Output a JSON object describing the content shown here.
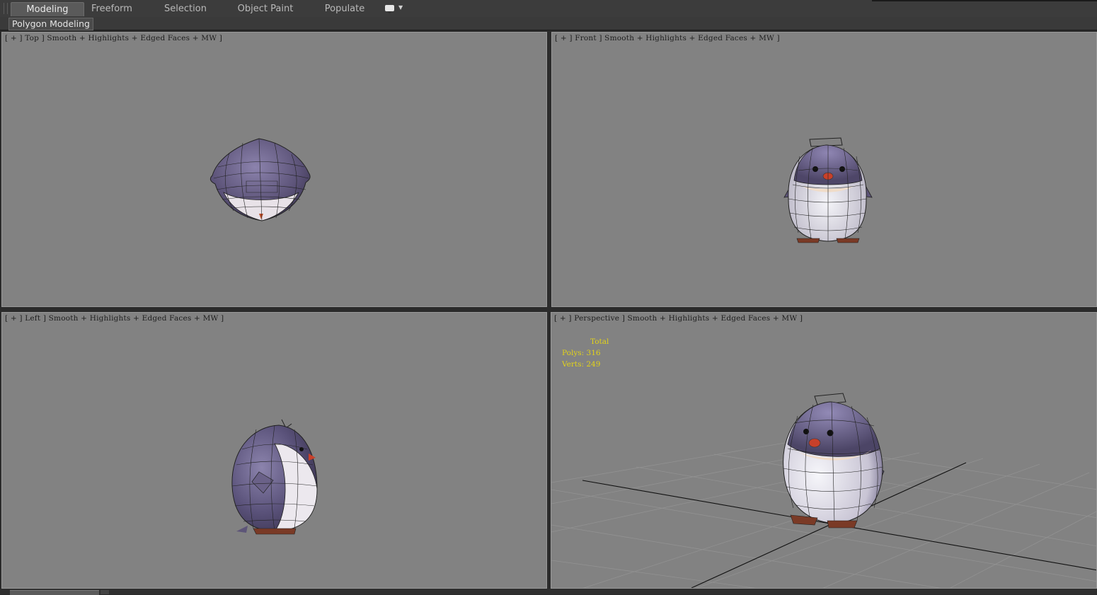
{
  "ribbon": {
    "tabs": [
      {
        "label": "Modeling",
        "active": true
      },
      {
        "label": "Freeform",
        "active": false
      },
      {
        "label": "Selection",
        "active": false
      },
      {
        "label": "Object Paint",
        "active": false
      },
      {
        "label": "Populate",
        "active": false
      }
    ],
    "panel_label": "Polygon Modeling"
  },
  "viewports": {
    "top": {
      "label": "[ + ] Top ] Smooth + Highlights + Edged Faces + MW ]"
    },
    "front": {
      "label": "[ + ] Front ] Smooth + Highlights + Edged Faces + MW ]"
    },
    "left": {
      "label": "[ + ] Left ] Smooth + Highlights + Edged Faces + MW ]"
    },
    "perspective": {
      "label": "[ + ] Perspective ] Smooth + Highlights + Edged Faces + MW ]",
      "stats": {
        "title": "Total",
        "polys": "Polys: 316",
        "verts": "Verts: 249"
      }
    }
  },
  "colors": {
    "viewport_bg": "#828282",
    "stats_text": "#e2d21a",
    "penguin_body": "#6c6488",
    "penguin_belly": "#efeff4"
  }
}
